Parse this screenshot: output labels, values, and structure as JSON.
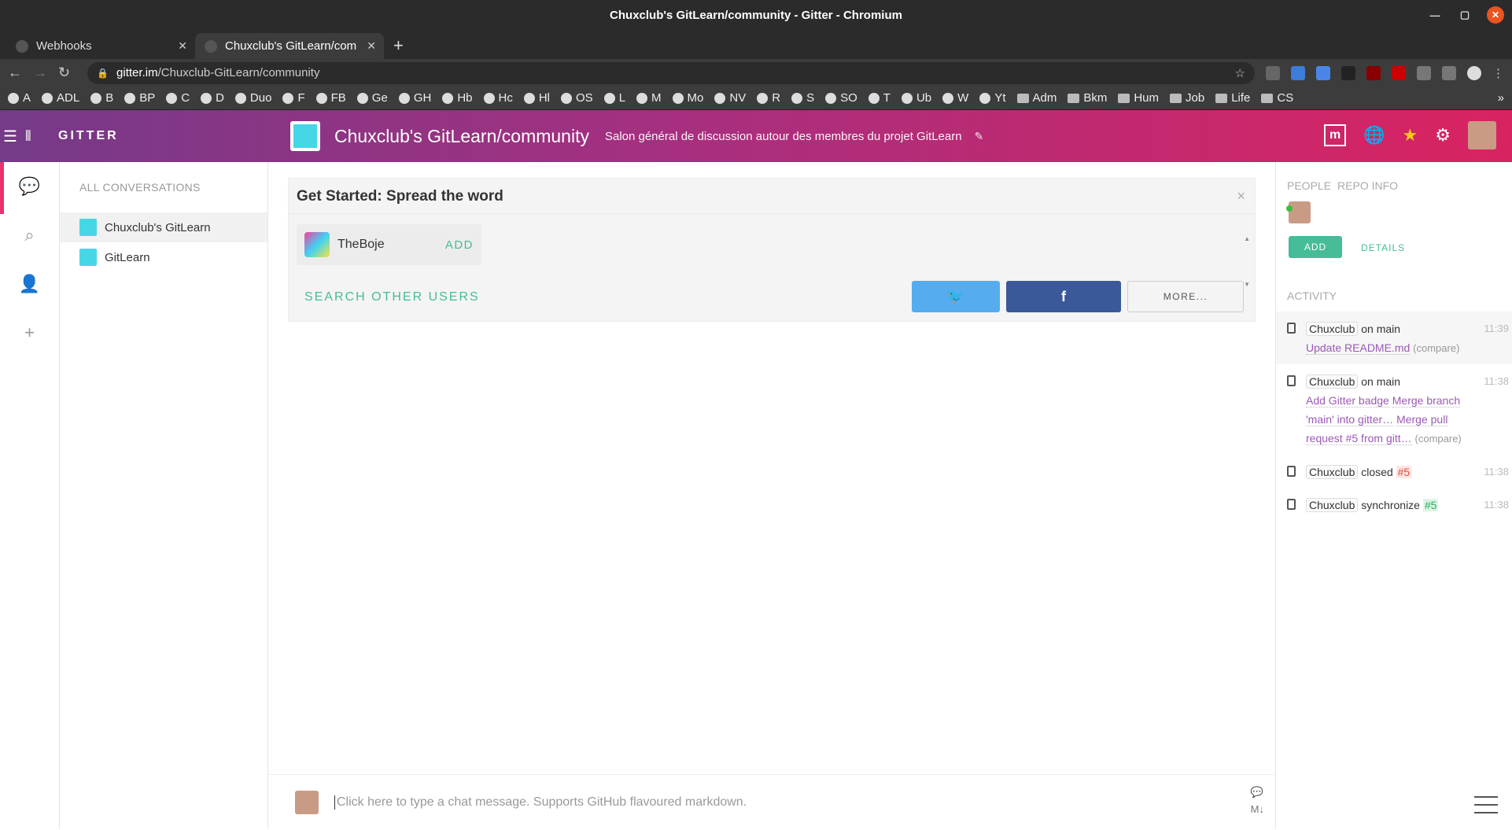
{
  "window": {
    "title": "Chuxclub's GitLearn/community - Gitter - Chromium"
  },
  "tabs": [
    {
      "label": "Webhooks"
    },
    {
      "label": "Chuxclub's GitLearn/com"
    }
  ],
  "address": {
    "host": "gitter.im",
    "path": "/Chuxclub-GitLearn/community"
  },
  "bookmarks": [
    "A",
    "ADL",
    "B",
    "BP",
    "C",
    "D",
    "Duo",
    "F",
    "FB",
    "Ge",
    "GH",
    "Hb",
    "Hc",
    "Hl",
    "OS",
    "L",
    "M",
    "Mo",
    "NV",
    "R",
    "S",
    "SO",
    "T",
    "Ub",
    "W",
    "Yt",
    "Adm",
    "Bkm",
    "Hum",
    "Job",
    "Life",
    "CS"
  ],
  "bookmark_folders": [
    "Adm",
    "Bkm",
    "Hum",
    "Job",
    "Life",
    "CS"
  ],
  "gitter": {
    "logo": "GITTER",
    "room_title": "Chuxclub's GitLearn/community",
    "room_topic": "Salon général de discussion autour des membres du projet GitLearn",
    "header_m": "m"
  },
  "sidebar": {
    "heading": "ALL CONVERSATIONS",
    "rooms": [
      {
        "name": "Chuxclub's GitLearn",
        "selected": true
      },
      {
        "name": "GitLearn",
        "selected": false
      }
    ]
  },
  "get_started": {
    "title": "Get Started: Spread the word",
    "close": "×",
    "suggested_user": "TheBoje",
    "add_label": "ADD",
    "search_label": "SEARCH OTHER USERS",
    "more_label": "MORE..."
  },
  "composer": {
    "placeholder": "Click here to type a chat message. Supports GitHub flavoured markdown."
  },
  "right_panel": {
    "tab_people": "PEOPLE",
    "tab_repo": "REPO INFO",
    "add_label": "ADD",
    "details_label": "DETAILS",
    "activity_heading": "ACTIVITY",
    "activity": [
      {
        "user": "Chuxclub",
        "action": "on main",
        "links": [
          "Update README.md"
        ],
        "compare": "(compare)",
        "time": "11:39"
      },
      {
        "user": "Chuxclub",
        "action": "on main",
        "links": [
          "Add Gitter badge",
          "Merge branch 'main' into gitter…",
          "Merge pull request #5 from gitt…"
        ],
        "compare": "(compare)",
        "time": "11:38"
      },
      {
        "user": "Chuxclub",
        "action": "closed",
        "pr": "#5",
        "time": "11:38"
      },
      {
        "user": "Chuxclub",
        "action": "synchronize",
        "pr": "#5",
        "time": "11:38"
      }
    ]
  },
  "colors": {
    "accent": "#46bc99",
    "header_start": "#753a88",
    "header_end": "#d92361",
    "twitter": "#55acee",
    "facebook": "#3b5998"
  }
}
